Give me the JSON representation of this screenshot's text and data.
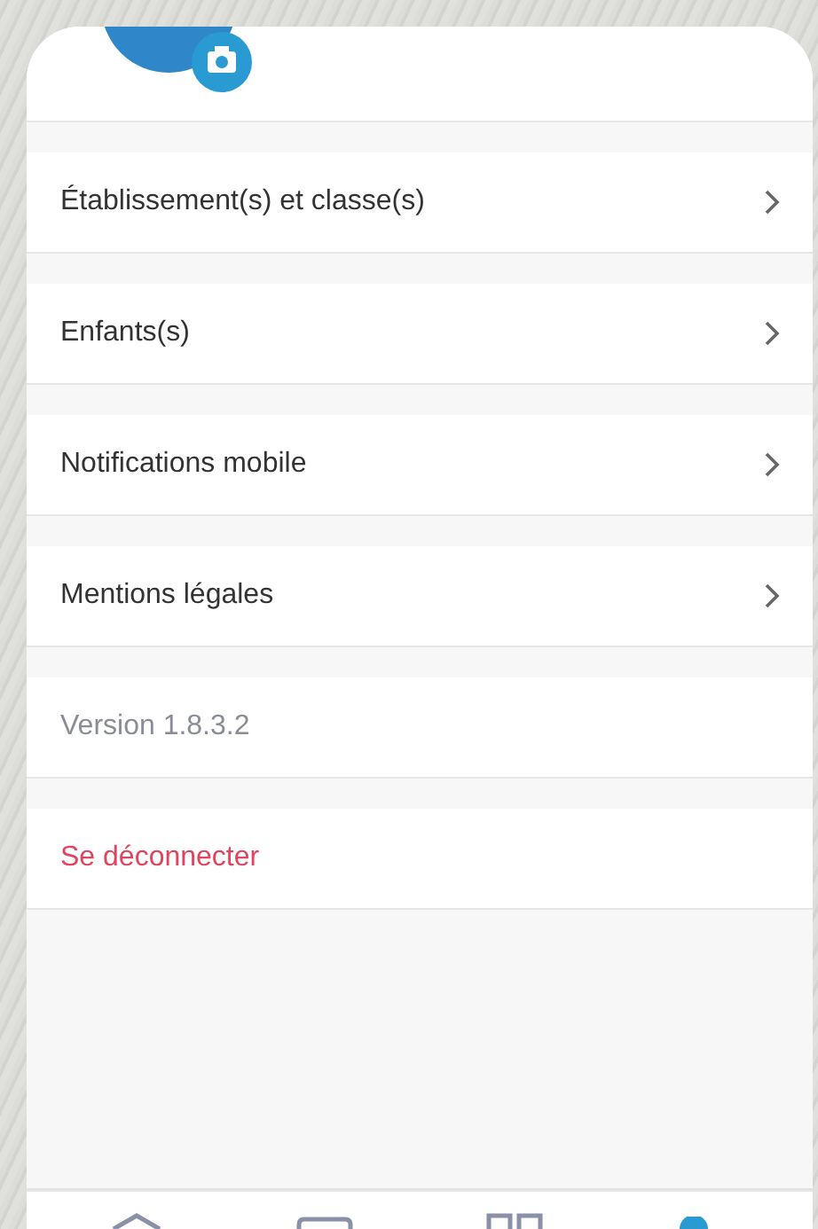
{
  "menu": [
    {
      "kind": "link",
      "label": "Établissement(s) et classe(s)"
    },
    {
      "kind": "link",
      "label": "Enfants(s)"
    },
    {
      "kind": "link",
      "label": "Notifications mobile"
    },
    {
      "kind": "link",
      "label": "Mentions légales"
    },
    {
      "kind": "info",
      "label": "Version 1.8.3.2"
    },
    {
      "kind": "danger",
      "label": "Se déconnecter"
    }
  ],
  "nav": [
    {
      "kind": "home",
      "selected": false
    },
    {
      "kind": "message",
      "selected": false
    },
    {
      "kind": "grid",
      "selected": false
    },
    {
      "kind": "profile",
      "selected": true
    }
  ]
}
